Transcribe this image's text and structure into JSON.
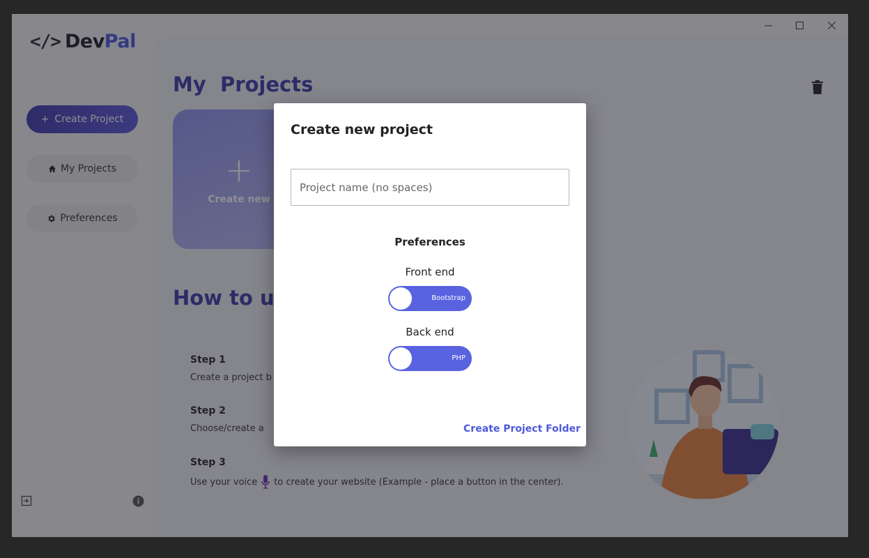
{
  "window": {
    "minimize_icon": "minimize-icon",
    "maximize_icon": "maximize-icon",
    "close_icon": "close-icon"
  },
  "sidebar": {
    "logo_mark": "</>",
    "logo_dev": "Dev",
    "logo_pal": "Pal",
    "create_button": "Create Project",
    "items": [
      {
        "label": "My Projects",
        "icon": "home-icon"
      },
      {
        "label": "Preferences",
        "icon": "gear-icon"
      }
    ]
  },
  "main": {
    "title": "My  Projects",
    "create_new_plus": "+",
    "create_new_label": "Create new",
    "how_title": "How to us",
    "steps": [
      {
        "title": "Step 1",
        "desc": "Create a project b"
      },
      {
        "title": "Step 2",
        "desc": "Choose/create a "
      },
      {
        "title": "Step 3",
        "desc_before": "Use your voice",
        "desc_after": "to create your website (Example - place a button in the center)."
      }
    ]
  },
  "modal": {
    "title": "Create new project",
    "name_placeholder": "Project name (no spaces)",
    "name_value": "",
    "preferences_title": "Preferences",
    "front_end_label": "Front end",
    "front_end_value": "Bootstrap",
    "back_end_label": "Back end",
    "back_end_value": "PHP",
    "submit_label": "Create Project Folder"
  },
  "colors": {
    "accent": "#4a56d9",
    "toggle": "#5963e0",
    "heading": "#3b3ba8"
  }
}
